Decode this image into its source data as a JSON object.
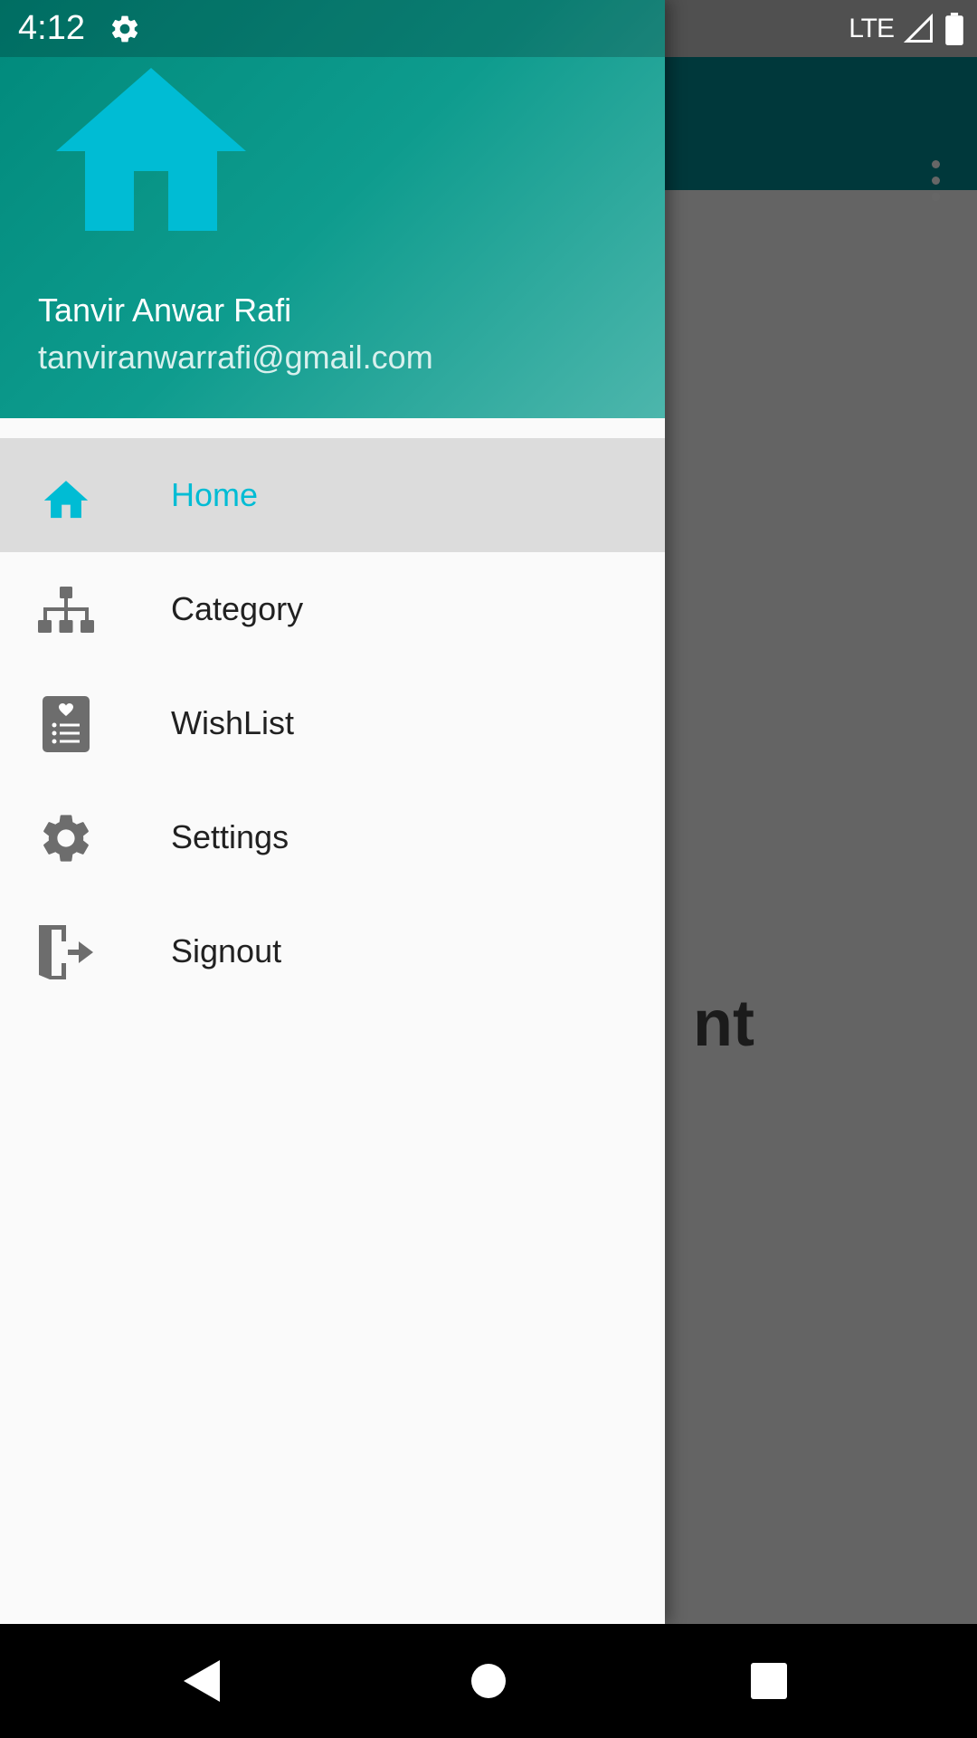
{
  "status_bar": {
    "time": "4:12",
    "network": "LTE",
    "icons": [
      "settings-gear-icon",
      "signal-icon",
      "battery-icon"
    ]
  },
  "background_app": {
    "toolbar_color": "#008c94",
    "content_text_fragment": "nt",
    "overflow_icon": "more-vert-icon"
  },
  "drawer": {
    "header": {
      "logo_icon": "home-icon",
      "name": "Tanvir Anwar Rafi",
      "email": "tanviranwarrafi@gmail.com"
    },
    "menu": [
      {
        "label": "Home",
        "icon": "home-icon",
        "selected": true
      },
      {
        "label": "Category",
        "icon": "sitemap-icon",
        "selected": false
      },
      {
        "label": "WishList",
        "icon": "wishlist-icon",
        "selected": false
      },
      {
        "label": "Settings",
        "icon": "gear-icon",
        "selected": false
      },
      {
        "label": "Signout",
        "icon": "signout-icon",
        "selected": false
      }
    ]
  },
  "nav_bar": {
    "buttons": [
      "back-icon",
      "home-circle-icon",
      "recents-icon"
    ]
  },
  "colors": {
    "accent": "#00bcd4",
    "header_start": "#00897b",
    "header_end": "#4db6ac",
    "icon_gray": "#6d6d6d"
  }
}
